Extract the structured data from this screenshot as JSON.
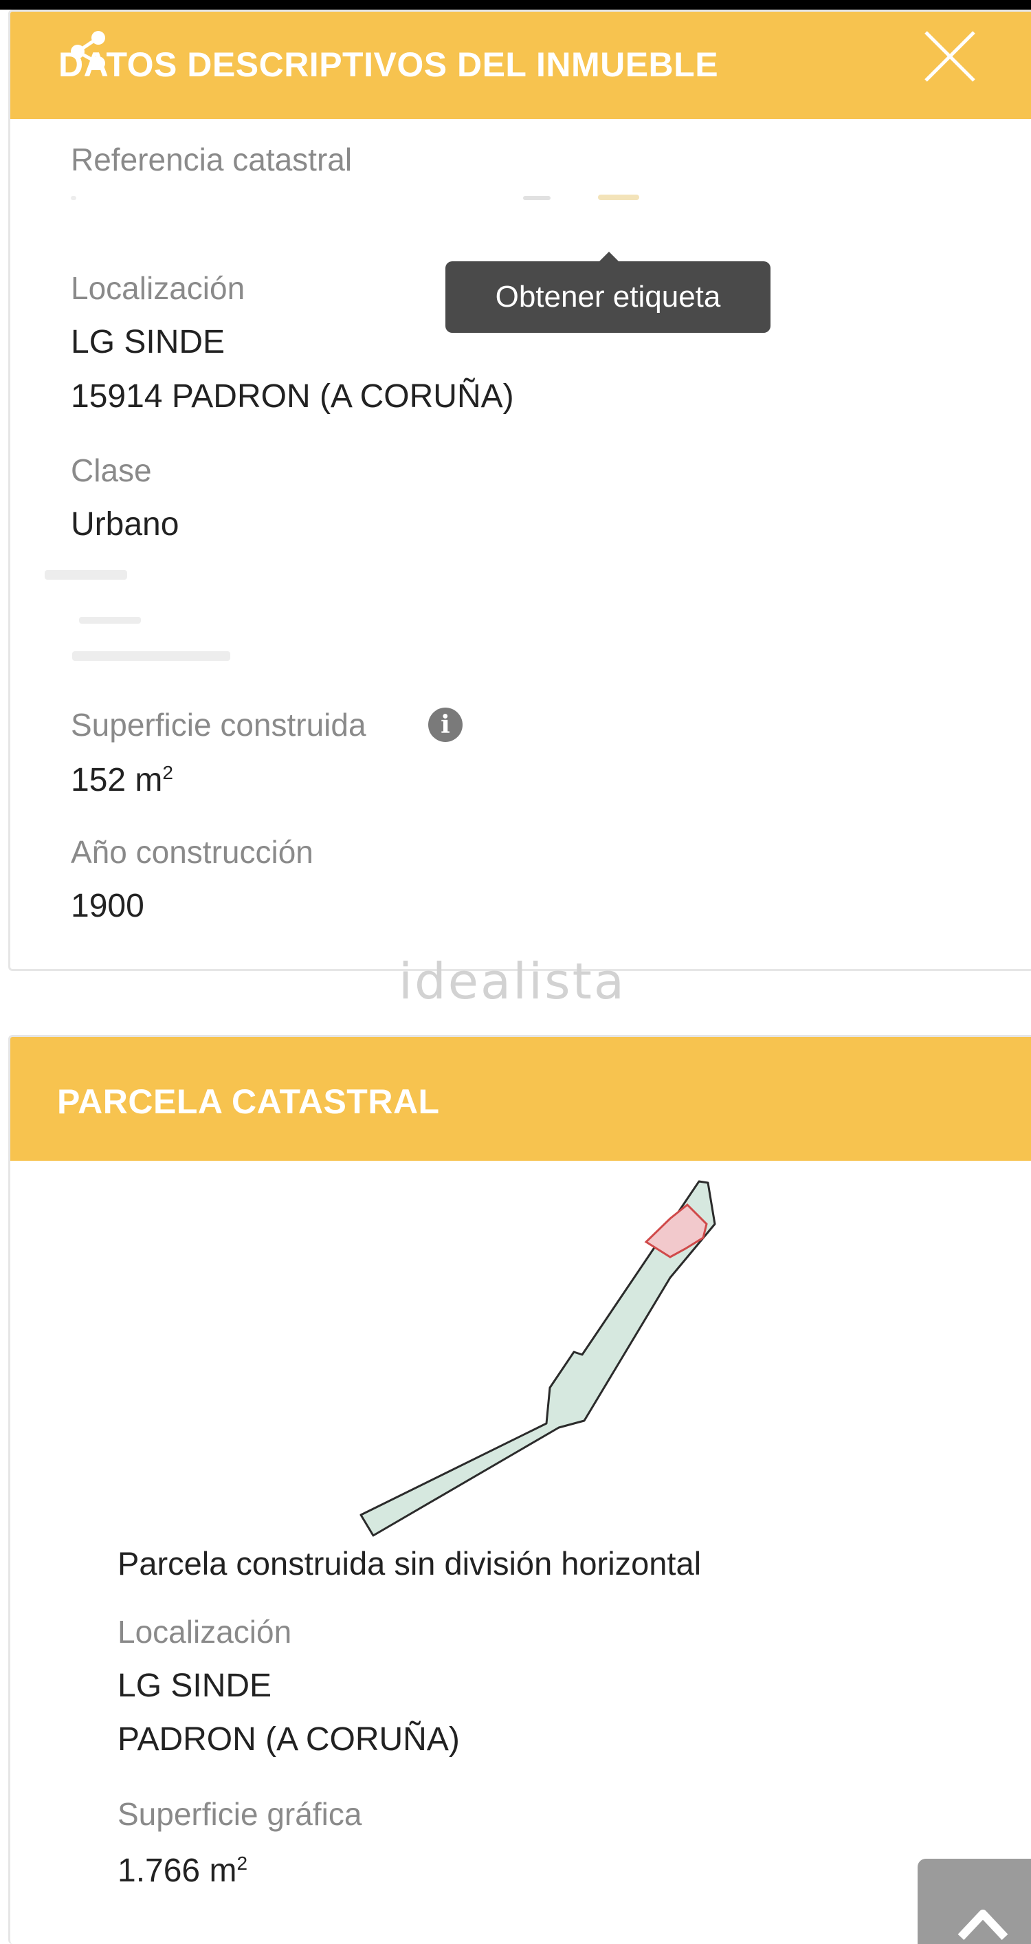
{
  "app": {
    "colors": {
      "header_bg": "#f7c34f",
      "parcel_fill": "#d6e8df",
      "building_fill": "#f2c9cc"
    },
    "icons": [
      "share-icon",
      "close-icon",
      "info-icon",
      "chevron-up-icon"
    ]
  },
  "section1": {
    "title": "DATOS DESCRIPTIVOS DEL INMUEBLE",
    "ref_label": "Referencia catastral",
    "loc_label": "Localización",
    "loc_line1": "LG SINDE",
    "loc_line2": "15914 PADRON (A CORUÑA)",
    "clase_label": "Clase",
    "clase_value": "Urbano",
    "superficie_label": "Superficie construida",
    "superficie_number": "152 m",
    "superficie_exp": "2",
    "anio_label": "Año construcción",
    "anio_value": "1900"
  },
  "tooltip": {
    "text": "Obtener etiqueta"
  },
  "watermark": "idealista",
  "section2": {
    "title": "PARCELA CATASTRAL",
    "subtitle": "Parcela construida sin división horizontal",
    "loc_label": "Localización",
    "loc_line1": "LG SINDE",
    "loc_line2": "PADRON (A CORUÑA)",
    "superficie_label": "Superficie gráfica",
    "superficie_number": "1.766 m",
    "superficie_exp": "2"
  }
}
